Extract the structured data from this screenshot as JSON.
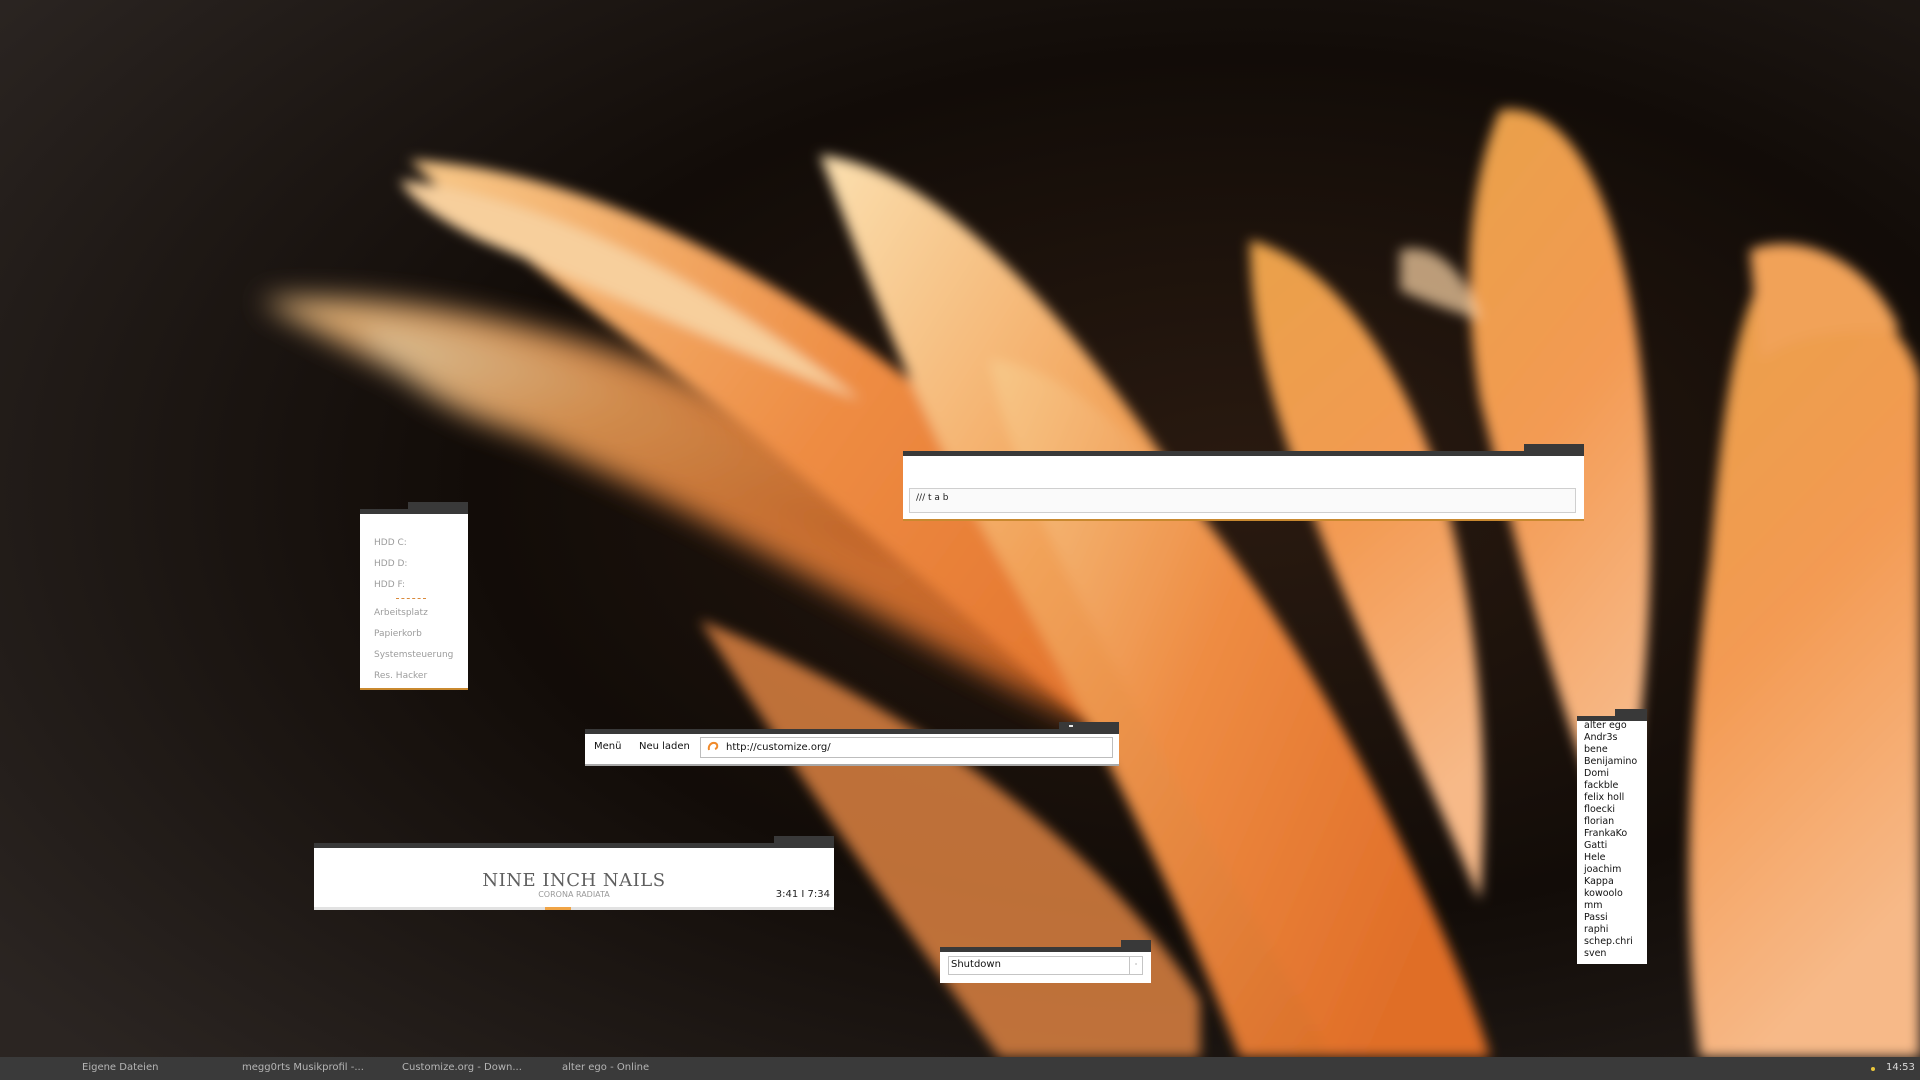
{
  "drives": {
    "hdd": [
      "HDD C:",
      "HDD D:",
      "HDD F:"
    ],
    "places": [
      "Arbeitsplatz",
      "Papierkorb",
      "Systemsteuerung",
      "Res. Hacker"
    ]
  },
  "tab_search": {
    "text": "/// t a b"
  },
  "browser": {
    "menu_label": "Menü",
    "reload_label": "Neu laden",
    "url": "http://customize.org/"
  },
  "player": {
    "artist": "NINE INCH NAILS",
    "track": "CORONA RADIATA",
    "time": "3:41  I  7:34",
    "progress_fraction": 0.47
  },
  "shutdown": {
    "selected": "Shutdown"
  },
  "buddies": [
    "alter ego",
    "Andr3s",
    "bene",
    "Benijamino",
    "Domi",
    "fackble",
    "felix holl",
    "floecki",
    "florian",
    "FrankaKo",
    "Gatti",
    "Hele",
    "joachim",
    "Kappa",
    "kowoolo",
    "mm",
    "Passi",
    "raphi",
    "schep.chri",
    "sven"
  ],
  "taskbar": {
    "tasks": [
      "Eigene Dateien",
      "megg0rts Musikprofil -...",
      "Customize.org - Down...",
      "alter ego - Online"
    ],
    "clock": "14:53"
  },
  "colors": {
    "accent": "#c9892f",
    "bar": "#393939",
    "taskbar": "#3a3a3a"
  }
}
